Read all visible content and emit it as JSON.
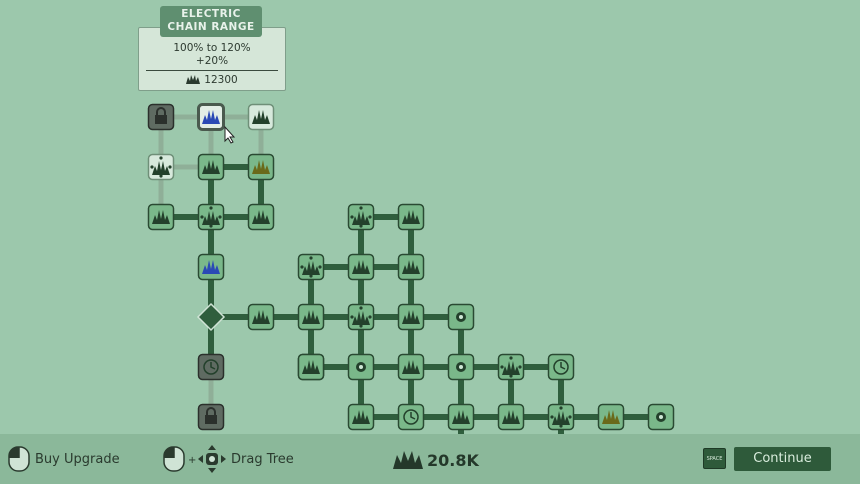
{
  "tooltip": {
    "title": "ELECTRIC CHAIN RANGE",
    "line1": "100% to 120%",
    "line2": "+20%",
    "cost": "12300"
  },
  "controls": {
    "buy_label": "Buy Upgrade",
    "plus": "+",
    "drag_label": "Drag Tree",
    "currency": "20.8K",
    "space_key": "SPACE",
    "continue_label": "Continue"
  },
  "colors": {
    "background": "#9cc8ac",
    "node_active": "#7ab88a",
    "node_locked": "#5f6b62",
    "node_available": "#d7e9dc",
    "edge_dark": "#2f5e3d",
    "edge_light": "#8faf98"
  },
  "nodes": [
    {
      "id": "lock-top",
      "state": "locked",
      "icon": "lock-icon"
    },
    {
      "id": "electric-chain-range",
      "state": "selected",
      "icon": "blue-grass-icon"
    },
    {
      "id": "n-top-right",
      "state": "available",
      "icon": "grass-icon"
    },
    {
      "id": "n-r2-left",
      "state": "available",
      "icon": "spread-icon"
    },
    {
      "id": "n-r2-mid",
      "state": "owned",
      "icon": "grass-icon"
    },
    {
      "id": "n-r2-right",
      "state": "owned",
      "icon": "yellow-grass-icon"
    },
    {
      "id": "n-r3-left",
      "state": "owned",
      "icon": "grass-icon"
    },
    {
      "id": "n-r3-mid",
      "state": "owned",
      "icon": "spread-icon"
    },
    {
      "id": "n-r3-right",
      "state": "owned",
      "icon": "grass-icon"
    },
    {
      "id": "n-blue",
      "state": "owned",
      "icon": "blue-grass-icon"
    },
    {
      "id": "hub",
      "state": "owned",
      "icon": "hub-icon"
    },
    {
      "id": "timer-dark",
      "state": "locked",
      "icon": "clock-icon"
    },
    {
      "id": "lock-bottom",
      "state": "locked",
      "icon": "lock-icon"
    },
    {
      "id": "g1",
      "state": "owned",
      "icon": "grass-icon"
    },
    {
      "id": "g2",
      "state": "owned",
      "icon": "spread-icon"
    },
    {
      "id": "g3",
      "state": "owned",
      "icon": "grass-icon"
    },
    {
      "id": "g4",
      "state": "owned",
      "icon": "grass-icon"
    },
    {
      "id": "g5",
      "state": "owned",
      "icon": "spread-icon"
    },
    {
      "id": "g6",
      "state": "owned",
      "icon": "grass-icon"
    },
    {
      "id": "g7",
      "state": "owned",
      "icon": "grass-icon"
    },
    {
      "id": "g8",
      "state": "owned",
      "icon": "grass-icon"
    },
    {
      "id": "g9",
      "state": "owned",
      "icon": "spread-icon"
    },
    {
      "id": "g10",
      "state": "owned",
      "icon": "grass-icon"
    },
    {
      "id": "g11",
      "state": "owned",
      "icon": "gear-icon"
    },
    {
      "id": "g12",
      "state": "owned",
      "icon": "grass-icon"
    },
    {
      "id": "g13",
      "state": "owned",
      "icon": "gear-icon"
    },
    {
      "id": "g14",
      "state": "owned",
      "icon": "grass-icon"
    },
    {
      "id": "g15",
      "state": "owned",
      "icon": "gear-icon"
    },
    {
      "id": "g16",
      "state": "owned",
      "icon": "spread-icon"
    },
    {
      "id": "g17",
      "state": "owned",
      "icon": "clock-icon"
    },
    {
      "id": "g18",
      "state": "owned",
      "icon": "grass-icon"
    },
    {
      "id": "g19",
      "state": "owned",
      "icon": "clock-icon"
    },
    {
      "id": "g20",
      "state": "owned",
      "icon": "grass-icon"
    },
    {
      "id": "g21",
      "state": "owned",
      "icon": "grass-icon"
    },
    {
      "id": "g22",
      "state": "owned",
      "icon": "spread-icon"
    },
    {
      "id": "g23",
      "state": "owned",
      "icon": "yellow-grass-icon"
    },
    {
      "id": "g24",
      "state": "owned",
      "icon": "gear-icon"
    }
  ]
}
